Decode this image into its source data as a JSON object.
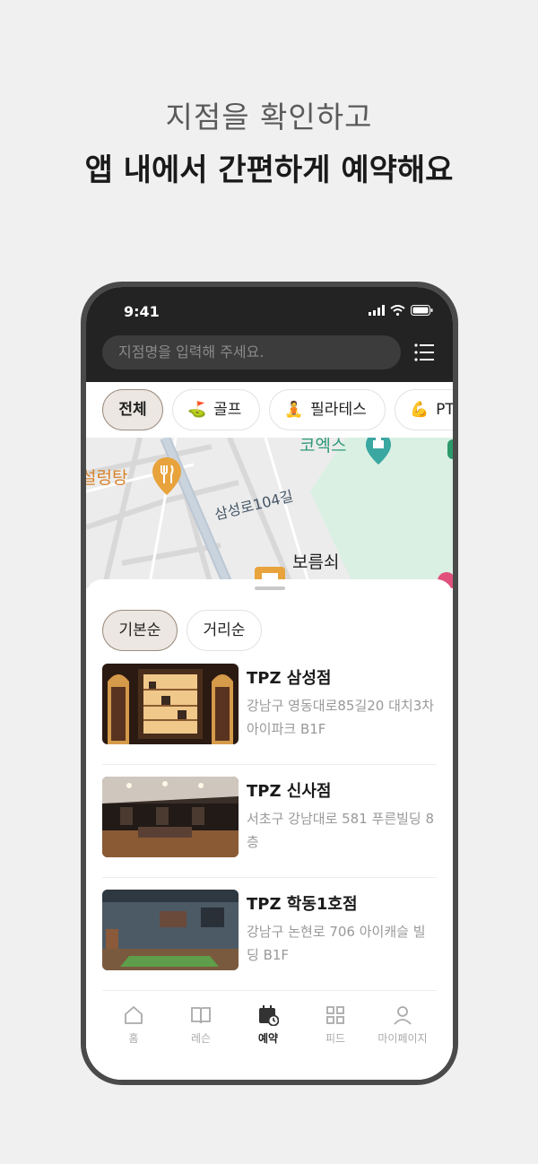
{
  "headline": {
    "line1": "지점을 확인하고",
    "line2": "앱 내에서 간편하게 예약해요"
  },
  "status": {
    "time": "9:41"
  },
  "search": {
    "placeholder": "지점명을 입력해 주세요."
  },
  "categories": [
    {
      "label": "전체",
      "icon": "",
      "active": true
    },
    {
      "label": "골프",
      "icon": "⛳",
      "active": false
    },
    {
      "label": "필라테스",
      "icon": "🧘",
      "active": false
    },
    {
      "label": "PT",
      "icon": "💪",
      "active": false
    }
  ],
  "map": {
    "labels": {
      "soup": "설렁탕",
      "road": "삼성로104길",
      "coex": "코엑스",
      "place": "보름쇠"
    },
    "icons": [
      "restaurant-pin-icon",
      "landmark-pin-icon",
      "store-pin-icon"
    ]
  },
  "sort": {
    "default_label": "기본순",
    "distance_label": "거리순",
    "selected": "기본순"
  },
  "stores": [
    {
      "name": "TPZ 삼성점",
      "address": "강남구 영동대로85길20 대치3차 아이파크 B1F"
    },
    {
      "name": "TPZ 신사점",
      "address": "서초구 강남대로 581 푸른빌딩 8층"
    },
    {
      "name": "TPZ 학동1호점",
      "address": "강남구 논현로 706 아이캐슬 빌딩 B1F"
    }
  ],
  "tabs": [
    {
      "label": "홈",
      "icon": "home-icon",
      "active": false
    },
    {
      "label": "레슨",
      "icon": "book-icon",
      "active": false
    },
    {
      "label": "예약",
      "icon": "calendar-clock-icon",
      "active": true
    },
    {
      "label": "피드",
      "icon": "grid-icon",
      "active": false
    },
    {
      "label": "마이페이지",
      "icon": "user-icon",
      "active": false
    }
  ],
  "colors": {
    "accent": "#9c8d80",
    "chip_active_bg": "#ece7e2",
    "topbar": "#232323",
    "map_park": "#d9f0e2",
    "pin_orange": "#e8a33c"
  }
}
